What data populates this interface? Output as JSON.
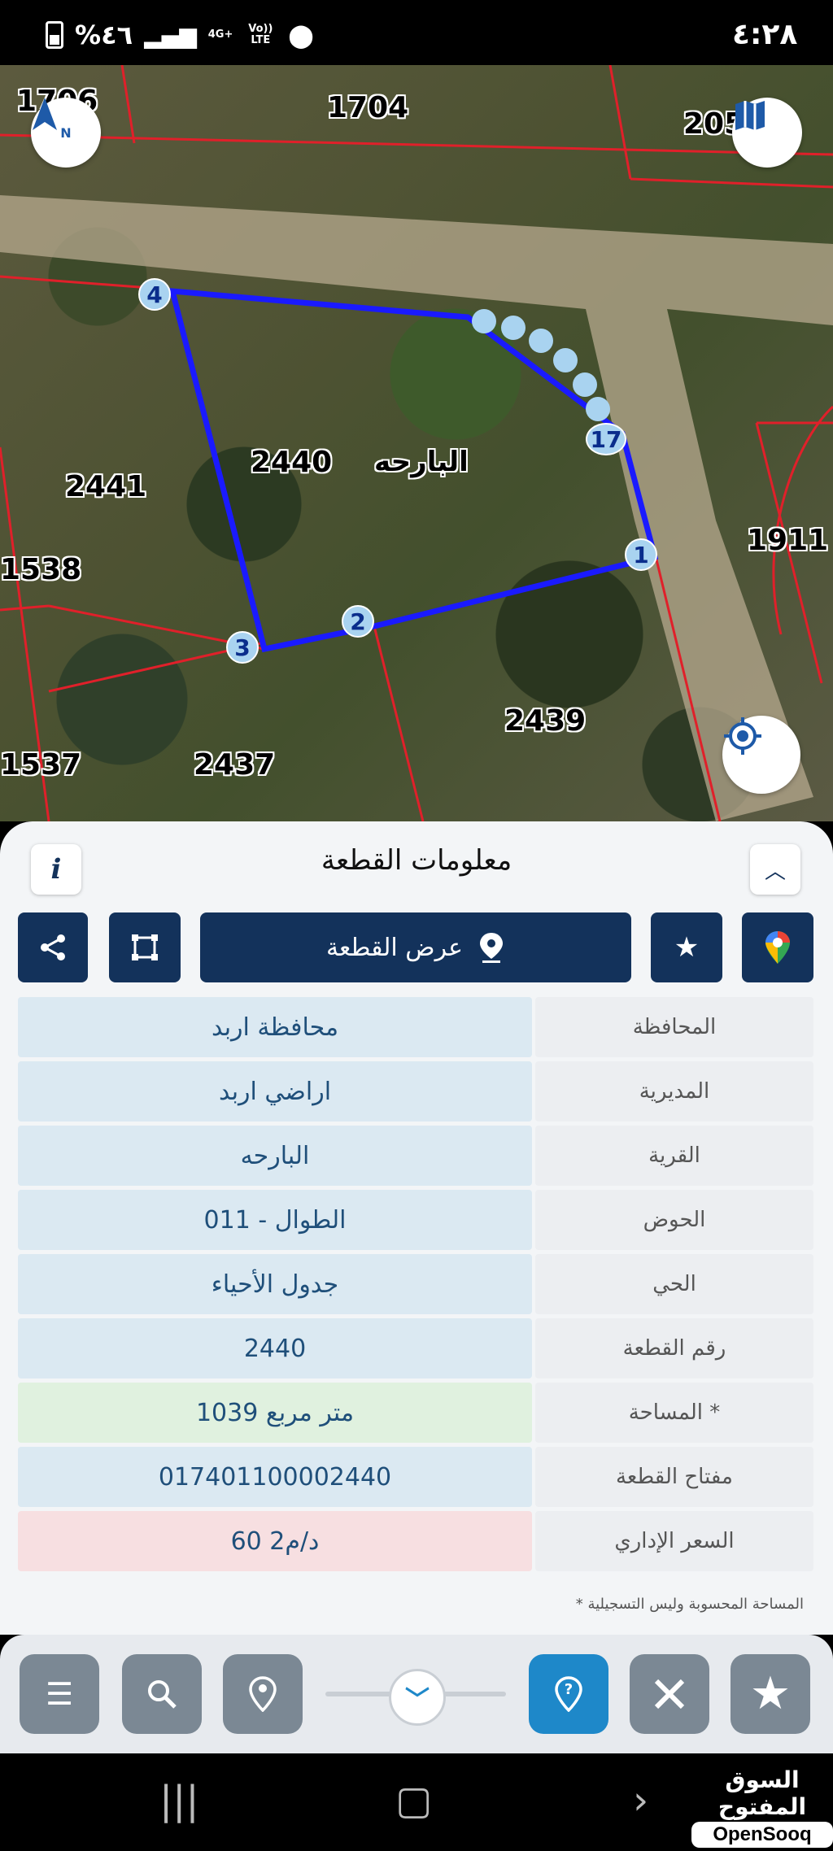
{
  "status": {
    "time": "٤:٢٨",
    "battery": "%٤٦",
    "network": "4G+",
    "volte": "Vo)) LTE"
  },
  "map": {
    "parcel_numbers": {
      "top_left": "1706",
      "top": "1704",
      "top_right": "205",
      "left": "2441",
      "main": "2440",
      "right": "1911",
      "left_1538": "1538",
      "bottom_right": "2439",
      "bottom_left": "1537",
      "bottom": "2437"
    },
    "village_label": "البارحه",
    "vertex_labels": [
      "1",
      "2",
      "3",
      "4",
      "17"
    ],
    "compass_label": "N",
    "icons": {
      "compass": "compass-icon",
      "layers": "map-layers-icon",
      "locate": "locate-icon"
    }
  },
  "panel": {
    "title": "معلومات القطعة",
    "show_parcel_label": "عرض القطعة",
    "fields": [
      {
        "label": "المحافظة",
        "value": "محافظة اربد",
        "bg": "#dbe9f2"
      },
      {
        "label": "المديرية",
        "value": "اراضي اربد",
        "bg": "#dbe9f2"
      },
      {
        "label": "القرية",
        "value": "البارحه",
        "bg": "#dbe9f2"
      },
      {
        "label": "الحوض",
        "value": "الطوال - 011",
        "bg": "#dbe9f2"
      },
      {
        "label": "الحي",
        "value": "جدول الأحياء",
        "bg": "#dbe9f2"
      },
      {
        "label": "رقم القطعة",
        "value": "2440",
        "bg": "#dbe9f2"
      },
      {
        "label": "المساحة *",
        "value": "1039   متر مربع",
        "bg": "#e0f1df"
      },
      {
        "label": "مفتاح القطعة",
        "value": "017401100002440",
        "bg": "#dbe9f2"
      },
      {
        "label": "السعر الإداري",
        "value": "60 د/م2",
        "bg": "#f7dfe1"
      }
    ],
    "footnote": "* المساحة المحسوبة وليس التسجيلية"
  },
  "brand": {
    "arabic": "السوق المفتوح",
    "english": "OpenSooq"
  },
  "colors": {
    "accent": "#13325b",
    "active": "#1e88c9",
    "parcel_outline": "#1a1aff"
  }
}
